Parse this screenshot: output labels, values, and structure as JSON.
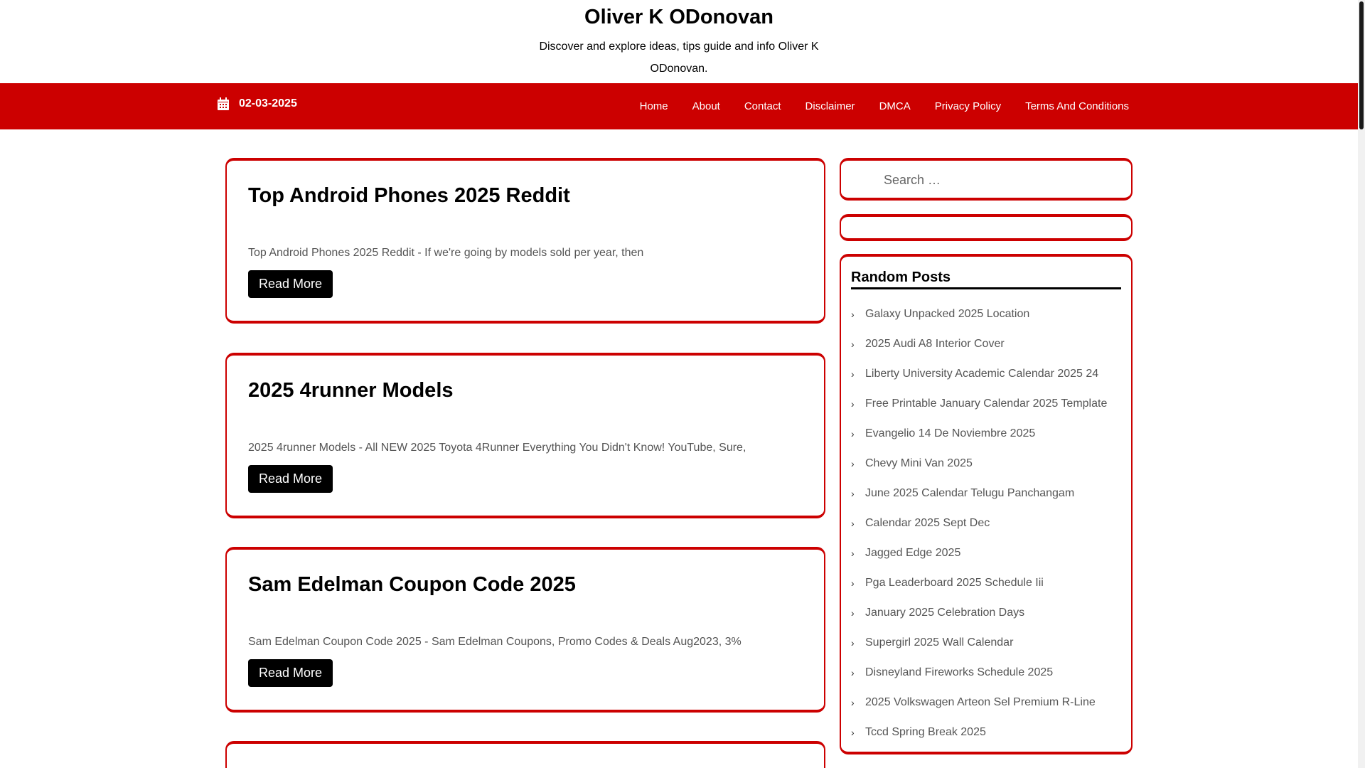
{
  "header": {
    "title": "Oliver K ODonovan",
    "description": "Discover and explore ideas, tips guide and info Oliver K ODonovan."
  },
  "nav": {
    "date": "02-03-2025",
    "menu": [
      "Home",
      "About",
      "Contact",
      "Disclaimer",
      "DMCA",
      "Privacy Policy",
      "Terms And Conditions"
    ]
  },
  "posts": [
    {
      "title": "Top Android Phones 2025 Reddit",
      "excerpt": "Top Android Phones 2025 Reddit - If we're going by models sold per year, then",
      "read_more": "Read More"
    },
    {
      "title": "2025 4runner Models",
      "excerpt": "2025 4runner Models - All NEW 2025 Toyota 4Runner Everything You Didn't Know! YouTube, Sure,",
      "read_more": "Read More"
    },
    {
      "title": "Sam Edelman Coupon Code 2025",
      "excerpt": "Sam Edelman Coupon Code 2025 - Sam Edelman Coupons, Promo Codes & Deals Aug2023, 3%",
      "read_more": "Read More"
    }
  ],
  "sidebar": {
    "search_placeholder": "Search …",
    "random_posts_title": "Random Posts",
    "random_posts": [
      "Galaxy Unpacked 2025 Location",
      "2025 Audi A8 Interior Cover",
      "Liberty University Academic Calendar 2025 24",
      "Free Printable January Calendar 2025 Template",
      "Evangelio 14 De Noviembre 2025",
      "Chevy Mini Van 2025",
      "June 2025 Calendar Telugu Panchangam",
      "Calendar 2025 Sept Dec",
      "Jagged Edge 2025",
      "Pga Leaderboard 2025 Schedule Iii",
      "January 2025 Celebration Days",
      "Supergirl 2025 Wall Calendar",
      "Disneyland Fireworks Schedule 2025",
      "2025 Volkswagen Arteon Sel Premium R-Line",
      "Tccd Spring Break 2025"
    ]
  },
  "colors": {
    "accent": "#cc0000",
    "button": "#000000"
  },
  "icons": {
    "date": "calendar-icon",
    "list_bullet": "chevron-right-icon"
  }
}
